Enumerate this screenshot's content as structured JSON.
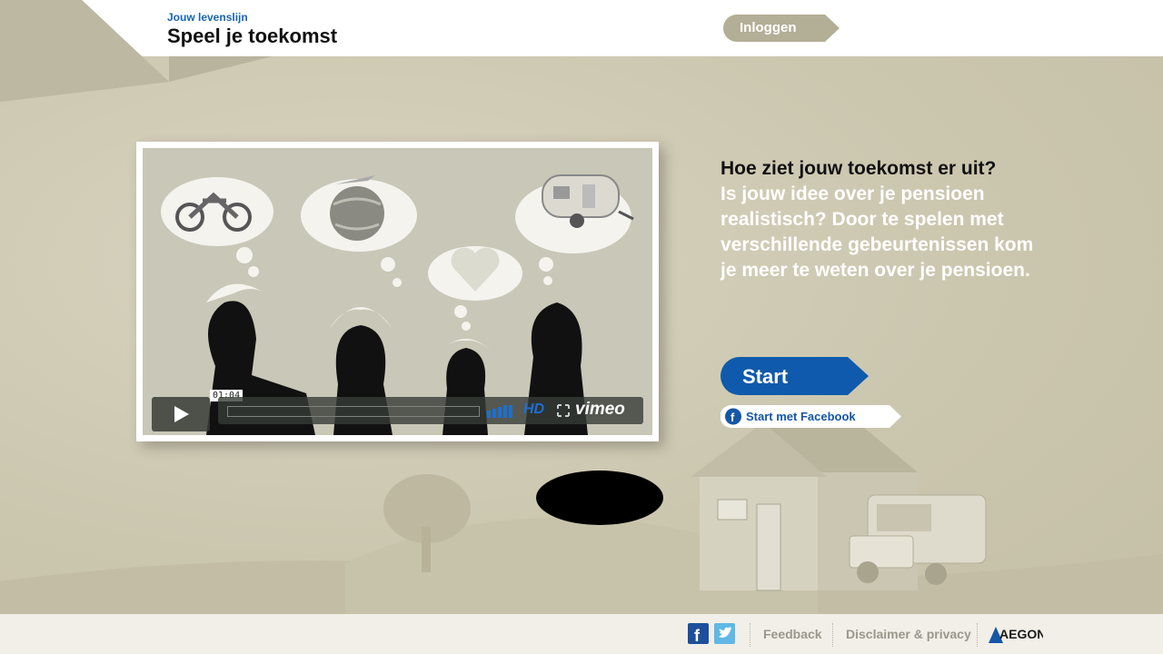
{
  "header": {
    "subtitle": "Jouw levenslijn",
    "title": "Speel je toekomst",
    "login_label": "Inloggen"
  },
  "video": {
    "timecode": "01:04",
    "hd_label": "HD",
    "brand_label": "vimeo"
  },
  "intro": {
    "question": "Hoe ziet jouw toekomst er uit?",
    "body": "Is jouw idee over je pensioen realistisch? Door te spelen met verschillende gebeurtenissen kom je meer te weten over je pensioen."
  },
  "cta": {
    "start_label": "Start",
    "facebook_label": "Start met Facebook"
  },
  "footer": {
    "feedback_label": "Feedback",
    "disclaimer_label": "Disclaimer & privacy",
    "brand_logo": "AEGON"
  },
  "colors": {
    "accent_blue": "#1764b8",
    "start_blue": "#0f5aac",
    "login_grey": "#b3ae96",
    "background": "#cfcab4"
  }
}
